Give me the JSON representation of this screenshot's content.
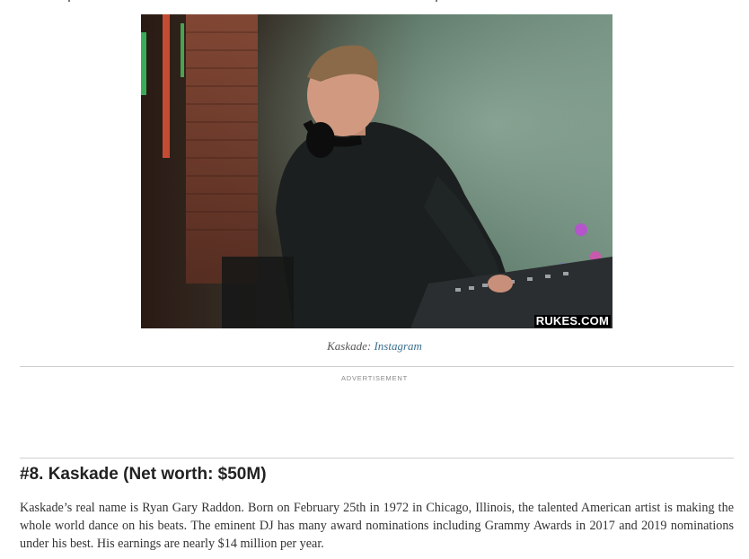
{
  "image": {
    "alt": "Kaskade DJing at a mixing console",
    "watermark": "RUKES.COM"
  },
  "caption": {
    "prefix": "Kaskade: ",
    "link_label": "Instagram"
  },
  "advertisement": {
    "label": "ADVERTISEMENT"
  },
  "section": {
    "heading": "#8. Kaskade (Net worth: $50M)",
    "body": "Kaskade’s real name is Ryan Gary Raddon. Born on February 25th in 1972 in Chicago, Illinois, the talented American artist is making the whole world dance on his beats. The eminent DJ has many award nominations including Grammy Awards in 2017 and 2019 nominations under his best. His earnings are nearly $14 million per year."
  },
  "colors": {
    "link": "#3a6f8f",
    "rule": "#cfcfcf",
    "heading": "#222222"
  }
}
